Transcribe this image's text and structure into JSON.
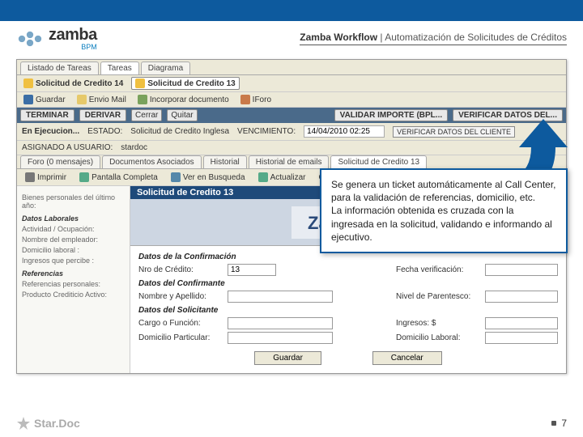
{
  "header": {
    "logo_text": "zamba",
    "logo_sub": "BPM",
    "breadcrumb_bold": "Zamba Workflow",
    "breadcrumb_sep": "  |  ",
    "breadcrumb_rest": "Automatización de Solicitudes de Créditos"
  },
  "tabs_top": {
    "t0": "Listado de Tareas",
    "t1": "Tareas",
    "t2": "Diagrama"
  },
  "toolbar1": {
    "b0": "Solicitud de Credito 14",
    "b1": "Solicitud de Credito 13"
  },
  "toolbar2": {
    "b0": "Guardar",
    "b1": "Envio Mail",
    "b2": "Incorporar documento",
    "b3": "IForo"
  },
  "darkbar": {
    "terminar": "TERMINAR",
    "derivar": "DERIVAR",
    "cerrar": "Cerrar",
    "quitar": "Quitar",
    "validar": "VALIDAR IMPORTE (BPL...",
    "verificar": "VERIFICAR DATOS DEL..."
  },
  "status": {
    "ejec": "En Ejecucion...",
    "estado_lbl": "ESTADO:",
    "estado_val": "Solicitud de Credito Inglesa",
    "venc_lbl": "VENCIMIENTO:",
    "venc_val": "14/04/2010 02:25",
    "verif_cliente": "VERIFICAR DATOS DEL CLIENTE",
    "asignado_lbl": "ASIGNADO A USUARIO:",
    "asignado_val": "stardoc"
  },
  "tabs_mid": {
    "t0": "Foro (0 mensajes)",
    "t1": "Documentos Asociados",
    "t2": "Historial",
    "t3": "Historial de emails",
    "t4": "Solicitud de Credito 13"
  },
  "toolbar3": {
    "b0": "Imprimir",
    "b1": "Pantalla Completa",
    "b2": "Ver en Busqueda",
    "b3": "Actualizar",
    "b4": "Cerrar"
  },
  "leftpanel": {
    "p0": "Bienes personales del último año:",
    "s1": "Datos Laborales",
    "f1": "Actividad / Ocupación:",
    "f2": "Nombre del empleador:",
    "f3": "Domicilio laboral :",
    "f4": "Ingresos que percibe :",
    "s2": "Referencias",
    "f5": "Referencias personales:",
    "f6": "Producto Crediticio Activo:"
  },
  "doc": {
    "title": "Solicitud de Credito 13",
    "banner_text": "Zamba",
    "sec_confirm": "Datos de la Confirmación",
    "nro_lbl": "Nro de Crédito:",
    "nro_val": "13",
    "fecha_lbl": "Fecha verificación:",
    "sec_confirmante": "Datos del Confirmante",
    "nombre_lbl": "Nombre y Apellido:",
    "nivel_lbl": "Nivel de Parentesco:",
    "sec_solicitante": "Datos del Solicitante",
    "cargo_lbl": "Cargo o Función:",
    "ingresos_lbl": "Ingresos: $",
    "dom_part_lbl": "Domicilio Particular:",
    "dom_lab_lbl": "Domicilio Laboral:",
    "btn_guardar": "Guardar",
    "btn_cancelar": "Cancelar"
  },
  "callout": {
    "p1": "Se genera un ticket automáticamente al Call Center, para la validación de referencias, domicilio, etc.",
    "p2": "La información obtenida es cruzada con la ingresada en la solicitud, validando e informando al ejecutivo."
  },
  "footer": {
    "logo": "Star.Doc",
    "page": "7"
  }
}
